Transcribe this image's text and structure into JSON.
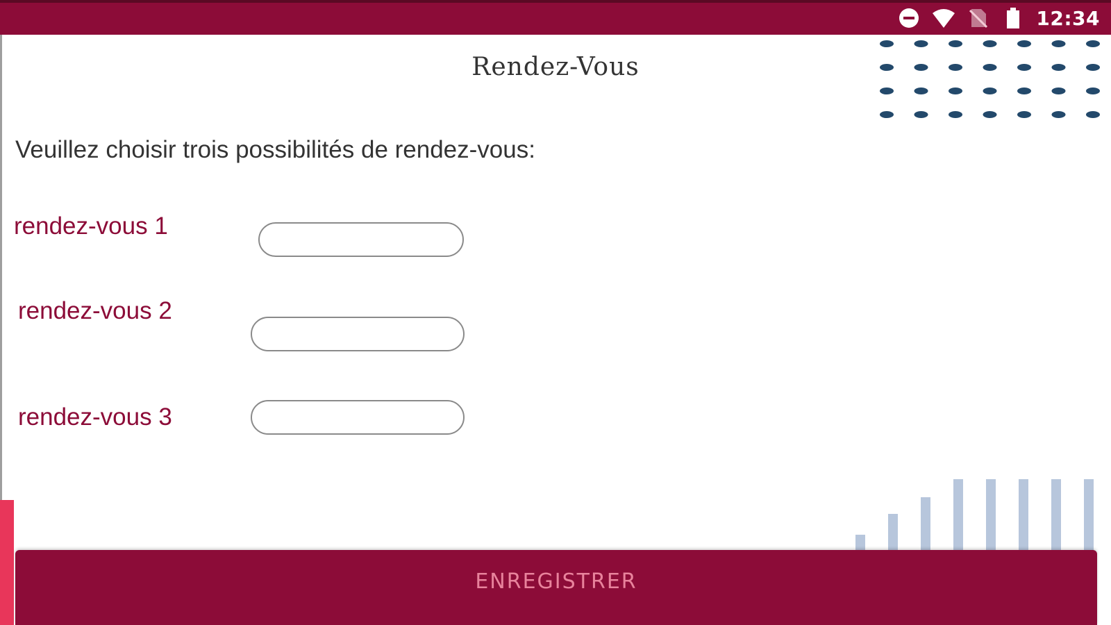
{
  "status_bar": {
    "time": "12:34",
    "icons": [
      "do-not-disturb-icon",
      "wifi-icon",
      "no-sim-icon",
      "battery-icon"
    ],
    "background_color": "#8c0c38"
  },
  "page": {
    "title": "Rendez-Vous",
    "instruction": "Veuillez choisir trois possibilités de rendez-vous:"
  },
  "form": {
    "fields": [
      {
        "label": "rendez-vous 1",
        "value": "",
        "placeholder": ""
      },
      {
        "label": "rendez-vous 2",
        "value": "",
        "placeholder": ""
      },
      {
        "label": "rendez-vous 3",
        "value": "",
        "placeholder": ""
      }
    ]
  },
  "actions": {
    "save_label": "ENREGISTRER"
  },
  "colors": {
    "accent": "#8c0c38",
    "label_text": "#8c0c38",
    "button_text": "#e8839c",
    "dots": "#23496b",
    "bars": "#b7c6dc"
  }
}
